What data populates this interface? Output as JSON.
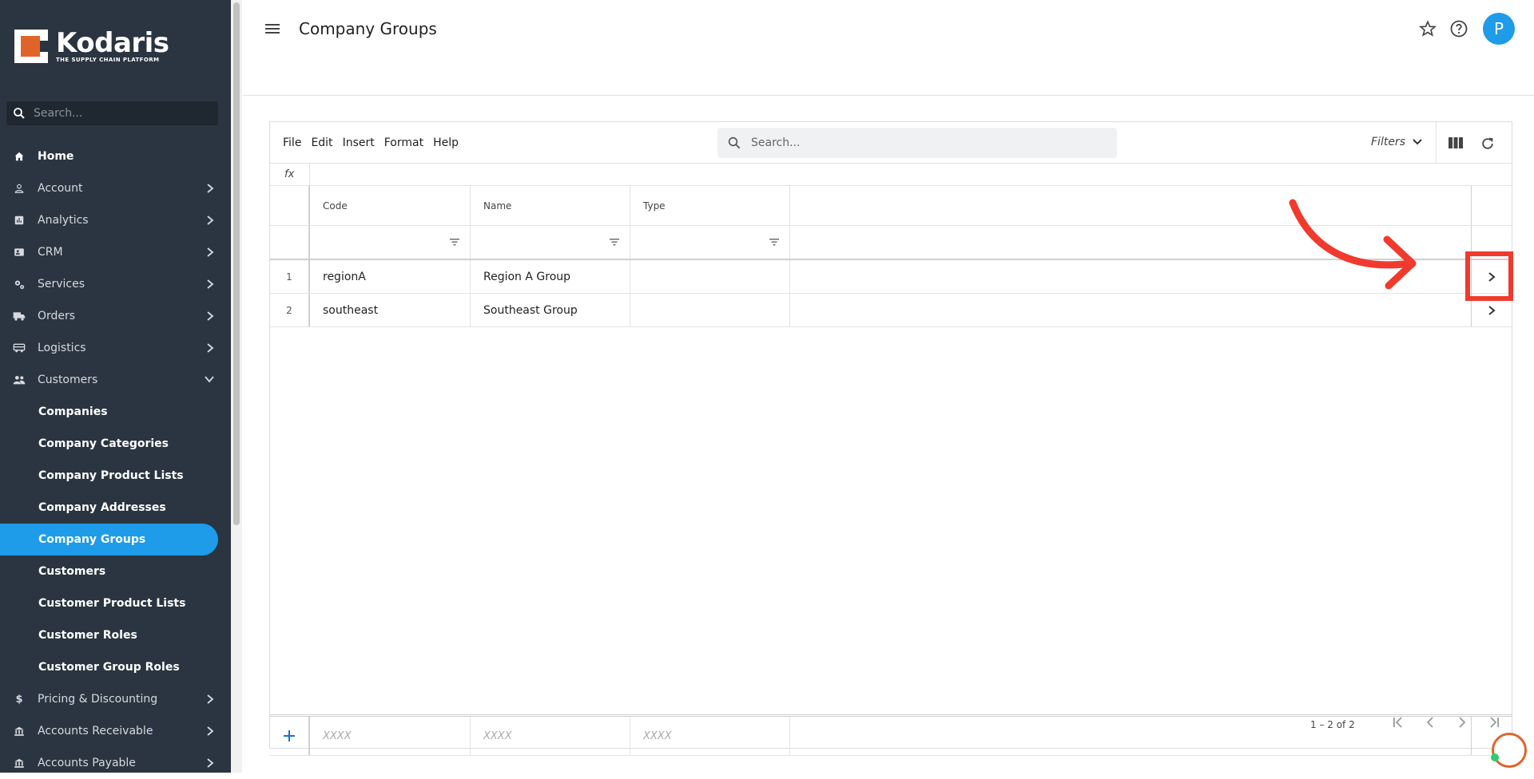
{
  "brand": {
    "name": "Kodaris",
    "tagline": "THE SUPPLY CHAIN PLATFORM",
    "accent": "#1e9be9",
    "logo_color": "#e0642a"
  },
  "sidebar": {
    "search_placeholder": "Search...",
    "items": [
      {
        "label": "Home",
        "icon": "home-icon",
        "expandable": false
      },
      {
        "label": "Account",
        "icon": "person-icon",
        "expandable": true
      },
      {
        "label": "Analytics",
        "icon": "analytics-icon",
        "expandable": true
      },
      {
        "label": "CRM",
        "icon": "contact-card-icon",
        "expandable": true
      },
      {
        "label": "Services",
        "icon": "gears-icon",
        "expandable": true
      },
      {
        "label": "Orders",
        "icon": "truck-icon",
        "expandable": true
      },
      {
        "label": "Logistics",
        "icon": "bus-icon",
        "expandable": true
      },
      {
        "label": "Customers",
        "icon": "people-icon",
        "expanded": true
      }
    ],
    "sub_items": [
      "Companies",
      "Company Categories",
      "Company Product Lists",
      "Company Addresses",
      "Company Groups",
      "Customers",
      "Customer Product Lists",
      "Customer Roles",
      "Customer Group Roles"
    ],
    "active_sub": "Company Groups",
    "after_items": [
      {
        "label": "Pricing & Discounting",
        "icon": "dollar-icon",
        "expandable": true
      },
      {
        "label": "Accounts Receivable",
        "icon": "bank-icon",
        "expandable": true
      },
      {
        "label": "Accounts Payable",
        "icon": "bank-icon",
        "expandable": true
      }
    ]
  },
  "header": {
    "title": "Company Groups",
    "avatar_letter": "P"
  },
  "toolbar": {
    "menus": [
      "File",
      "Edit",
      "Insert",
      "Format",
      "Help"
    ],
    "search_placeholder": "Search...",
    "filters_label": "Filters"
  },
  "formula_bar": {
    "label": "fx"
  },
  "table": {
    "columns": [
      "Code",
      "Name",
      "Type"
    ],
    "rows": [
      {
        "num": "1",
        "code": "regionA",
        "name": "Region A Group",
        "type": ""
      },
      {
        "num": "2",
        "code": "southeast",
        "name": "Southeast Group",
        "type": ""
      }
    ],
    "new_row_placeholders": [
      "XXXX",
      "XXXX",
      "XXXX"
    ]
  },
  "pager": {
    "range_text": "1 – 2 of 2"
  },
  "annotation_color": "#f03a2e"
}
